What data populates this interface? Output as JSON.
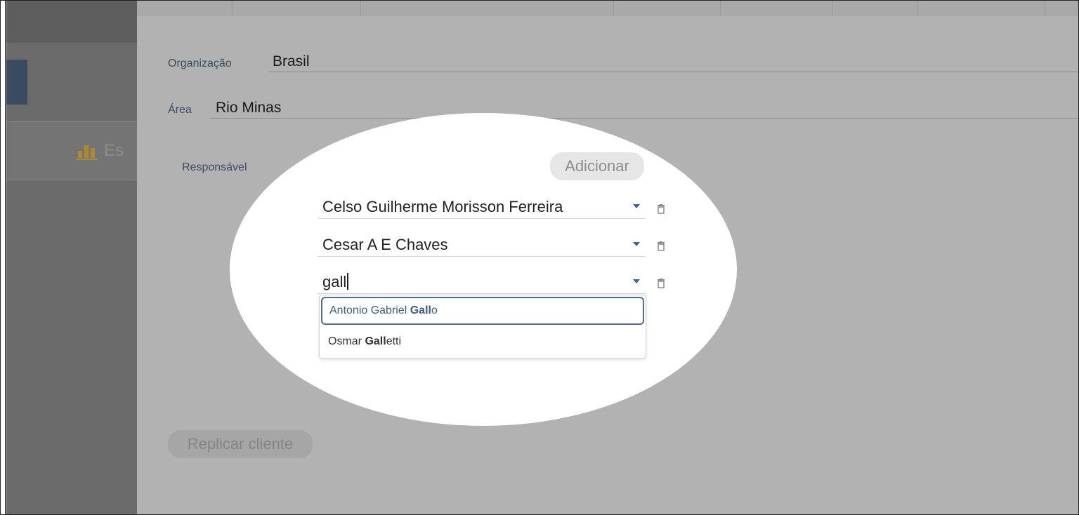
{
  "sidebar": {
    "partial_label": "Es",
    "icon": "bar-chart-icon"
  },
  "form": {
    "organization_label": "Organização",
    "organization_value": "Brasil",
    "area_label": "Área",
    "area_value": "Rio Minas",
    "responsible_label": "Responsável",
    "add_button": "Adicionar",
    "replicate_button": "Replicar cliente"
  },
  "responsibles": [
    {
      "value": "Celso Guilherme Morisson Ferreira"
    },
    {
      "value": "Cesar A E Chaves"
    },
    {
      "value": "gall"
    }
  ],
  "suggestions": [
    {
      "prefix": "Antonio Gabriel ",
      "match": "Gall",
      "suffix": "o"
    },
    {
      "prefix": "Osmar ",
      "match": "Gall",
      "suffix": "etti"
    }
  ],
  "colors": {
    "accent": "#3a63a8",
    "highlight_border": "#4a6d9e",
    "label_text": "#3b4b60"
  }
}
